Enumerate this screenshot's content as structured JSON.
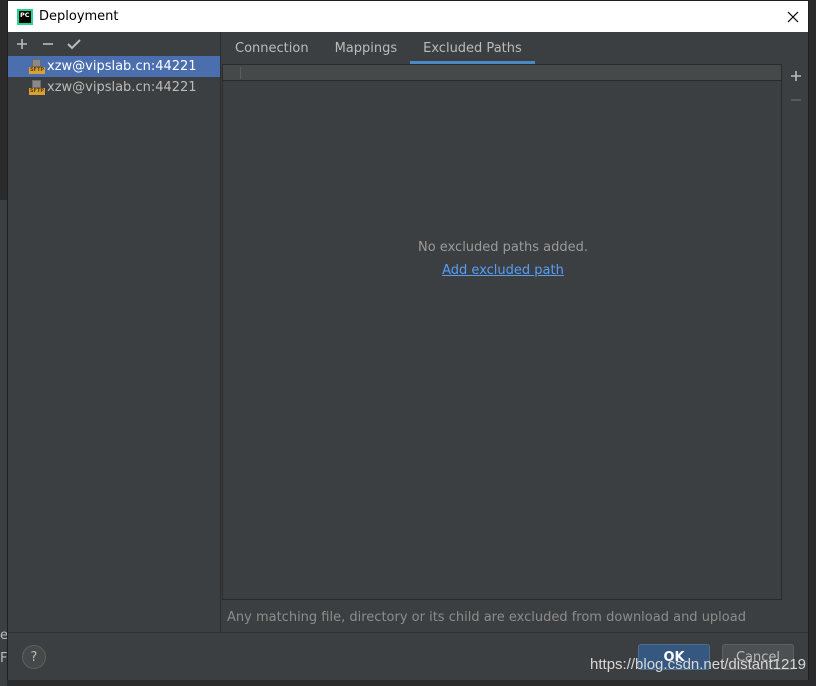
{
  "window": {
    "title": "Deployment",
    "app_icon_text": "PC"
  },
  "left": {
    "servers": [
      {
        "name": "xzw@vipslab.cn:44221",
        "icon_label": "SFTP",
        "selected": true
      },
      {
        "name": "xzw@vipslab.cn:44221",
        "icon_label": "SFTP",
        "selected": false
      }
    ]
  },
  "tabs": [
    {
      "label": "Connection"
    },
    {
      "label": "Mappings"
    },
    {
      "label": "Excluded Paths",
      "active": true
    }
  ],
  "excluded": {
    "empty_text": "No excluded paths added.",
    "add_link": "Add excluded path",
    "hint": "Any matching file, directory or its child are excluded from download and upload"
  },
  "buttons": {
    "help": "?",
    "ok": "OK",
    "cancel": "Cancel"
  },
  "background_chars": [
    "e",
    "F"
  ],
  "watermark": "https://blog.csdn.net/distant1219",
  "colors": {
    "accent": "#4a88c7",
    "selection": "#4b6eaf",
    "link": "#589df6",
    "panel": "#3c3f41"
  }
}
